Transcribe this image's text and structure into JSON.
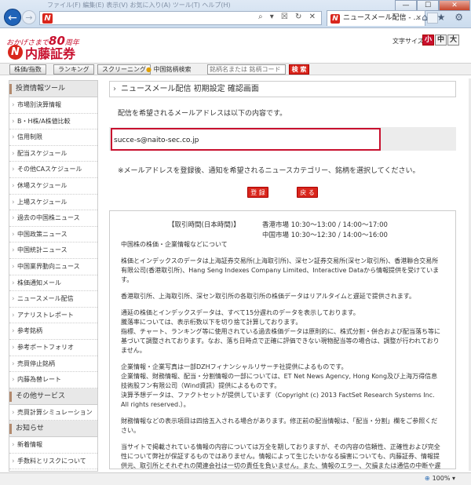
{
  "browser": {
    "faded_menu": "ファイル(F)  編集(E)  表示(V)  お気に入り(A)  ツール(T)  ヘルプ(H)",
    "address_tools": "⌕ ▾ ☒ ↻ ✕",
    "tab_title": "ニュースメール配信 - ...",
    "tab_close": "×",
    "win_min": "—",
    "win_max": "☐",
    "win_close": "✕",
    "toolbar_icons": "⌂ ★ ⚙"
  },
  "header": {
    "slogan_prefix": "おかげさまで",
    "slogan_number": "80",
    "slogan_suffix": "周年",
    "logo_mark": "N",
    "logo_text": "内藤証券",
    "font_size_label": "文字サイズ",
    "font_small": "小",
    "font_mid": "中",
    "font_large": "大"
  },
  "toolbar": {
    "btn_stock": "株価/指数",
    "btn_ranking": "ランキング",
    "btn_screening": "スクリーニング",
    "search_label": "中国銘柄検索",
    "search_placeholder": "銘柄名または 銘柄コード",
    "search_button": "検 索"
  },
  "sidebar": {
    "sections": [
      {
        "title": "投資情報ツール",
        "items": [
          "市場別決算情報",
          "B・H株/A株値比較",
          "信用制限",
          "配当スケジュール",
          "その他CAスケジュール",
          "休場スケジュール",
          "上場スケジュール",
          "過去の中国株ニュース",
          "中国政策ニュース",
          "中国統計ニュース",
          "中国業界動向ニュース",
          "株価通知メール",
          "ニュースメール配信",
          "アナリストレポート",
          "参考銘柄",
          "参考ポートフォリオ",
          "売買停止銘柄",
          "内藤為替レート"
        ]
      },
      {
        "title": "その他サービス",
        "items": [
          "売買計算シミュレーション"
        ]
      },
      {
        "title": "お知らせ",
        "items": [
          "新着情報",
          "手数料とリスクについて"
        ]
      }
    ]
  },
  "main": {
    "page_title": "ニュースメール配信 初期設定 確認画面",
    "note1": "配信を希望されるメールアドレスは以下の内容です。",
    "email": "succe-s@naito-sec.co.jp",
    "note2": "※メールアドレスを登録後、通知を希望されるニュースカテゴリー、銘柄を選択してください。",
    "btn_register": "登 録",
    "btn_back": "戻 る"
  },
  "disclaimer": {
    "hours_label": "【取引時間(日本時間)】",
    "hours_hk": "香港市場 10:30～13:00 / 14:00～17:00",
    "hours_cn": "中国市場 10:30～12:30 / 14:00～16:00",
    "paragraphs": [
      "中国株の株価・企業情報などについて",
      "株価とインデックスのデータは上海証券交易所(上海取引所)、深セン証券交易所(深セン取引所)、香港聯合交易所有限公司(香港取引所)、Hang Seng Indexes Company Limited、Interactive Dataから情報提供を受けています。",
      "香港取引所、上海取引所、深セン取引所の各取引所の株価データはリアルタイムと遅延で提供されます。",
      "通延の株価とインデックスデータは、すべて15分遅れのデータを表示しております。\n騰落率については、表示桁数以下を切り捨て計算しております。\n指標、チャート、ランキング等に使用されている過去株価データは原則的に、株式分割・併合および配当落ち等に基づいて調整されております。なお、落ち日時点で正確に評価できない現物配当等の場合は、調整が行われておりません。",
      "企業情報・企業写真は一部DZHフィナンシャルリサーチ社提供によるものです。\n企業情報、財務情報、配当・分割情報の一部については、ET Net News Agency, Hong Kong及び上海万得信息技術股フン有限公司（Wind資訊）提供によるものです。\n決算予想データは、ファクトセットが提供しています（Copyright (c) 2013 FactSet Research Systems Inc. All rights reserved.）。",
      "財務情報などの表示項目は四捨五入される場合があります。修正前の配当情報は、「配当・分割」欄をご参照ください。",
      "当サイトで掲載されている情報の内容については万全を期しておりますが、その内容の信頼性、正確性および完全性について弊社が保証するものではありません。情報によって生じたいかなる損害についても、内藤証券、情報提供元、取引所とそれぞれの関連会社は一切の責任を負いません。また、情報のエラー、欠損または通信の中断や遅延が生ずる場合があります。"
    ]
  },
  "status": {
    "zoom": "100%"
  }
}
